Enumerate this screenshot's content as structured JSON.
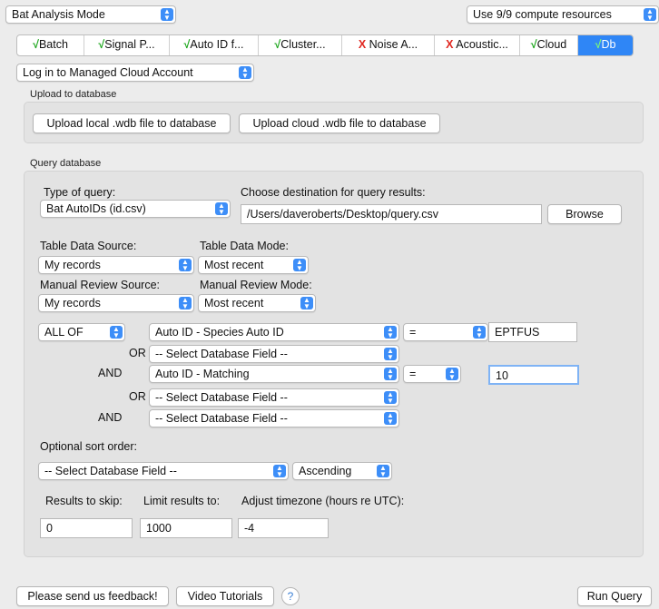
{
  "top": {
    "mode_select": "Bat Analysis Mode",
    "compute_select": "Use 9/9 compute resources"
  },
  "tabs": [
    {
      "status": "ok",
      "mark": "√",
      "label": "Batch"
    },
    {
      "status": "ok",
      "mark": "√",
      "label": "Signal P..."
    },
    {
      "status": "ok",
      "mark": "√",
      "label": "Auto ID f..."
    },
    {
      "status": "ok",
      "mark": "√",
      "label": "Cluster..."
    },
    {
      "status": "bad",
      "mark": "X",
      "label": "Noise A..."
    },
    {
      "status": "bad",
      "mark": "X",
      "label": "Acoustic..."
    },
    {
      "status": "ok",
      "mark": "√",
      "label": "Cloud"
    },
    {
      "status": "ok",
      "mark": "√",
      "label": "Db",
      "active": true
    }
  ],
  "login_select": "Log in to Managed Cloud Account",
  "upload": {
    "title": "Upload to database",
    "local_button": "Upload local .wdb file to database",
    "cloud_button": "Upload cloud .wdb file to database"
  },
  "query": {
    "title": "Query database",
    "type_label": "Type of query:",
    "type_select": "Bat AutoIDs (id.csv)",
    "dest_label": "Choose destination for query results:",
    "dest_value": "/Users/daveroberts/Desktop/query.csv",
    "browse_button": "Browse",
    "table_source_label": "Table Data Source:",
    "table_source_select": "My records",
    "table_mode_label": "Table Data Mode:",
    "table_mode_select": "Most recent",
    "review_source_label": "Manual Review Source:",
    "review_source_select": "My records",
    "review_mode_label": "Manual Review Mode:",
    "review_mode_select": "Most recent",
    "all_of_select": "ALL OF",
    "conditions": {
      "c1_field": "Auto ID - Species Auto ID",
      "c1_op": "=",
      "c1_value": "EPTFUS",
      "c2_conj": "OR",
      "c2_field": "-- Select Database Field --",
      "c3_conj": "AND",
      "c3_field": "Auto ID - Matching",
      "c3_op": "=",
      "c3_value": "10",
      "c4_conj": "OR",
      "c4_field": "-- Select Database Field --",
      "c5_conj": "AND",
      "c5_field": "-- Select Database Field --"
    },
    "sort_label": "Optional sort order:",
    "sort_field_select": "-- Select Database Field --",
    "sort_dir_select": "Ascending",
    "skip_label": "Results to skip:",
    "skip_value": "0",
    "limit_label": "Limit results to:",
    "limit_value": "1000",
    "tz_label": "Adjust timezone (hours re UTC):",
    "tz_value": "-4"
  },
  "footer": {
    "feedback_button": "Please send us feedback!",
    "tutorials_button": "Video Tutorials",
    "help": "?",
    "run_button": "Run Query"
  },
  "colors": {
    "accent": "#2f86f6",
    "ok": "#1aa51a",
    "bad": "#e0261f"
  }
}
